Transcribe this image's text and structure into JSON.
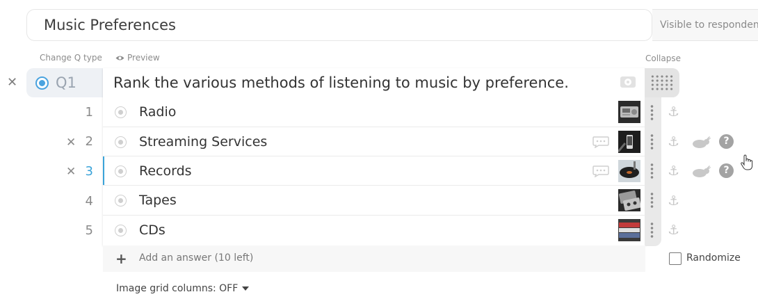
{
  "survey": {
    "title": "Music Preferences",
    "visibility_label": "Visible to respondents"
  },
  "labels": {
    "change_q_type": "Change Q type",
    "preview": "Preview",
    "collapse": "Collapse"
  },
  "question": {
    "number": "Q1",
    "text": "Rank the various methods of listening to music by preference.",
    "accent_color": "#4aa3df"
  },
  "answers": [
    {
      "index": "1",
      "text": "Radio",
      "thumbnail": "radio-photo",
      "removable": false,
      "has_comment_icon": false,
      "extra_tools": false,
      "selected": false
    },
    {
      "index": "2",
      "text": "Streaming Services",
      "thumbnail": "phone-streaming-photo",
      "removable": true,
      "has_comment_icon": true,
      "extra_tools": true,
      "selected": false
    },
    {
      "index": "3",
      "text": "Records",
      "thumbnail": "turntable-photo",
      "removable": true,
      "has_comment_icon": true,
      "extra_tools": true,
      "selected": true
    },
    {
      "index": "4",
      "text": "Tapes",
      "thumbnail": "cassette-photo",
      "removable": false,
      "has_comment_icon": false,
      "extra_tools": false,
      "selected": false
    },
    {
      "index": "5",
      "text": "CDs",
      "thumbnail": "cd-stack-photo",
      "removable": false,
      "has_comment_icon": false,
      "extra_tools": false,
      "selected": false
    }
  ],
  "add_answer": {
    "label": "Add an answer (10 left)"
  },
  "randomize": {
    "label": "Randomize",
    "checked": false
  },
  "image_grid": {
    "label": "Image grid columns: OFF"
  }
}
